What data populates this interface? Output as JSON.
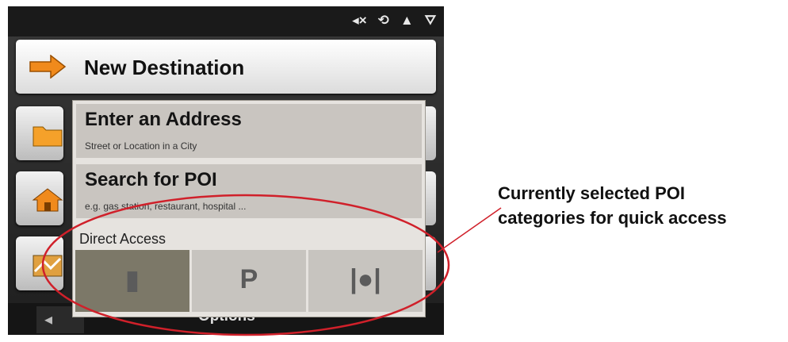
{
  "status_bar": {
    "icons": [
      "volume-muted-icon",
      "map-icon",
      "warning-icon",
      "gps-satellite-icon"
    ],
    "mute_glyph": "◂×",
    "map_glyph": "⟲",
    "warning_glyph": "▲",
    "gps_glyph": "⛛"
  },
  "new_destination": {
    "label": "New Destination",
    "icon": "orange-arrow-right-icon"
  },
  "side_tiles": [
    "folder-icon",
    "home-icon",
    "map-tile-icon"
  ],
  "panel": {
    "options": [
      {
        "title": "Enter an Address",
        "subtitle": "Street or Location in a City"
      },
      {
        "title": "Search for POI",
        "subtitle": "e.g. gas station, restaurant, hospital ..."
      }
    ],
    "direct_access_label": "Direct Access",
    "direct_access": [
      {
        "name": "fuel-pump-icon",
        "glyph": "▮",
        "selected": true
      },
      {
        "name": "parking-icon",
        "glyph": "P",
        "selected": false
      },
      {
        "name": "restaurant-icon",
        "glyph": "|●|",
        "selected": false
      }
    ]
  },
  "bottom_bar": {
    "back_glyph": "◂",
    "options_label": "Options"
  },
  "annotation": {
    "text_line1": "Currently selected POI",
    "text_line2": "categories for quick access",
    "color": "#d0202a"
  },
  "colors": {
    "accent_orange": "#f08a1c",
    "selected_tile": "#7c7868"
  }
}
